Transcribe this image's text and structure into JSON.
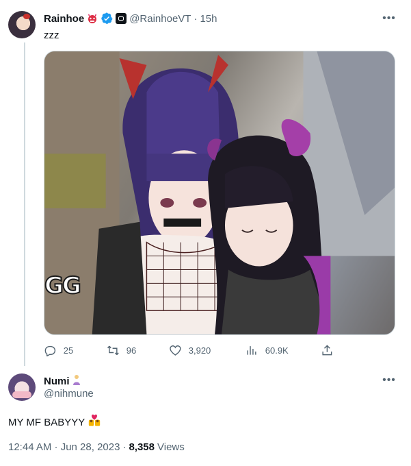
{
  "parent_tweet": {
    "display_name": "Rainhoe",
    "handle": "@RainhoeVT",
    "separator": "·",
    "time": "15h",
    "text": "zzz",
    "media_overlay_text": "GG",
    "actions": {
      "replies": "25",
      "retweets": "96",
      "likes": "3,920",
      "views": "60.9K"
    }
  },
  "reply_tweet": {
    "display_name": "Numi",
    "handle": "@nihmune",
    "text": "MY MF BABYYY",
    "timestamp": "12:44 AM · Jun 28, 2023",
    "separator": "·",
    "views_count": "8,358",
    "views_label": "Views"
  },
  "icons": [
    "more-icon",
    "verified-icon",
    "reply-icon",
    "retweet-icon",
    "like-icon",
    "views-icon",
    "share-icon"
  ],
  "colors": {
    "accent": "#1d9bf0",
    "text": "#0f1419",
    "secondary": "#536471",
    "border": "#cfd9de"
  }
}
